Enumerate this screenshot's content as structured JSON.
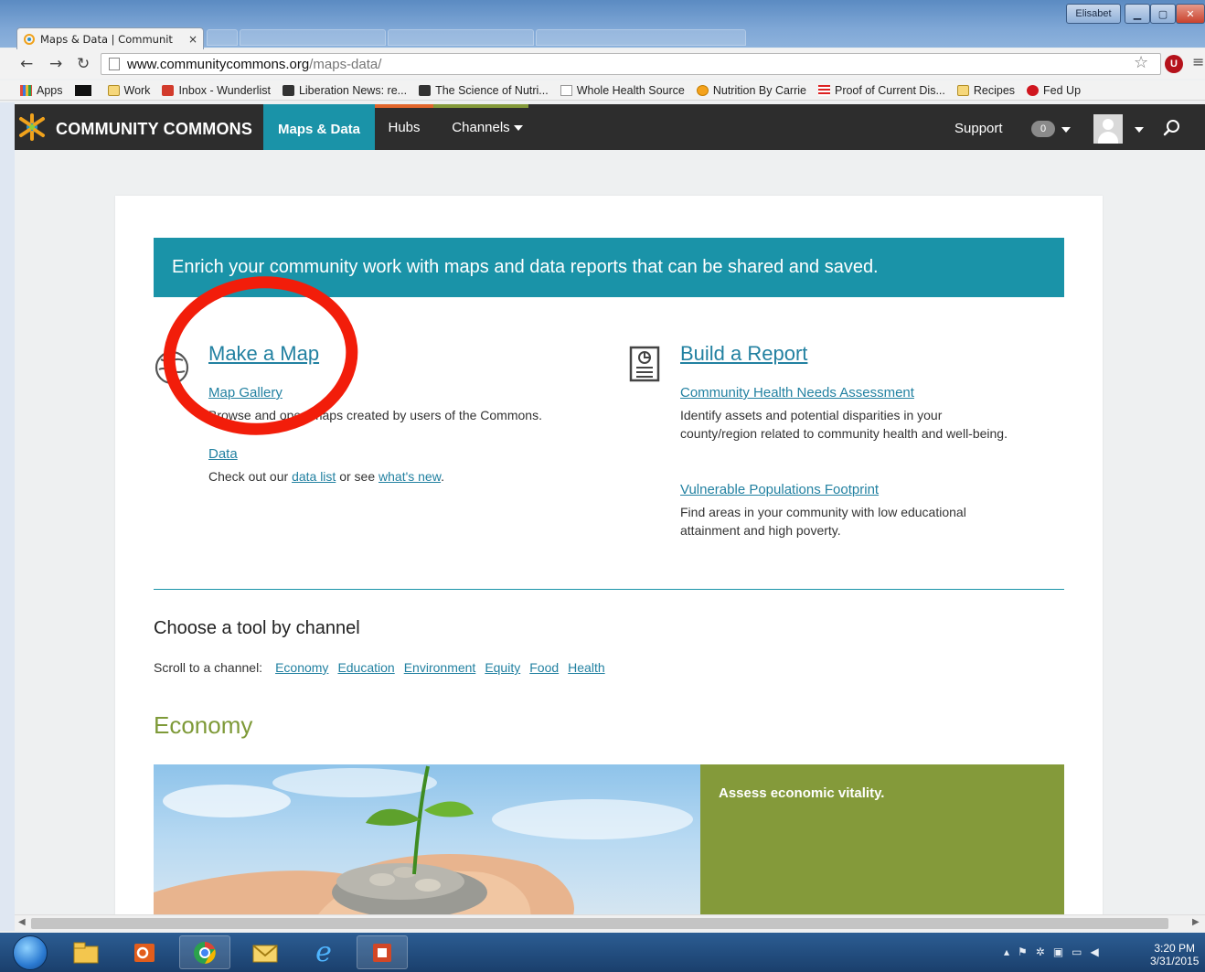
{
  "browser": {
    "tab_title": "Maps & Data | Communit",
    "tab_close": "×",
    "user_chip": "Elisabet",
    "url_host": "www.communitycommons.org",
    "url_path": "/maps-data/",
    "bookmarks": [
      {
        "label": "Apps",
        "icon": "apps-icon"
      },
      {
        "label": "",
        "icon": "bbc-icon"
      },
      {
        "label": "Work",
        "icon": "folder-icon"
      },
      {
        "label": "Inbox - Wunderlist",
        "icon": "wunderlist-icon"
      },
      {
        "label": "Liberation News: re...",
        "icon": "liberation-news-icon"
      },
      {
        "label": "The Science of Nutri...",
        "icon": "science-icon"
      },
      {
        "label": "Whole Health Source",
        "icon": "document-icon"
      },
      {
        "label": "Nutrition By Carrie",
        "icon": "nutrition-icon"
      },
      {
        "label": "Proof of Current Dis...",
        "icon": "flag-icon"
      },
      {
        "label": "Recipes",
        "icon": "folder-icon"
      },
      {
        "label": "Fed Up",
        "icon": "stop-icon"
      }
    ]
  },
  "site": {
    "name": "COMMUNITY COMMONS",
    "nav": {
      "maps": "Maps & Data",
      "hubs": "Hubs",
      "channels": "Channels",
      "support": "Support",
      "notifications": "0"
    },
    "colors": {
      "teal": "#1a93a8",
      "hubs_accent": "#e2662b",
      "channels_accent": "#849a3a",
      "olive": "#849a3a"
    }
  },
  "page": {
    "banner": "Enrich your community work with maps and data reports that can be shared and saved.",
    "make_map": {
      "title": "Make a Map",
      "gallery_link": "Map Gallery",
      "gallery_desc": "Browse and open maps created by users of the Commons.",
      "data_link": "Data",
      "data_prefix": "Check out our ",
      "data_list_link": "data list",
      "data_middle": " or see ",
      "whats_new_link": "what's new",
      "data_suffix": "."
    },
    "build_report": {
      "title": "Build a Report",
      "chna_link": "Community Health Needs Assessment",
      "chna_desc": "Identify assets and potential disparities in your county/region related to community health and well-being.",
      "vpf_link": "Vulnerable Populations Footprint",
      "vpf_desc": "Find areas in your community with low educational attainment and high poverty."
    },
    "channels_heading": "Choose a tool by channel",
    "scroll_label": "Scroll to a channel:",
    "channel_links": [
      "Economy",
      "Education",
      "Environment",
      "Equity",
      "Food",
      "Health"
    ],
    "economy_heading": "Economy",
    "economy_panel": "Assess economic vitality."
  },
  "taskbar": {
    "time": "3:20 PM",
    "date": "3/31/2015"
  }
}
